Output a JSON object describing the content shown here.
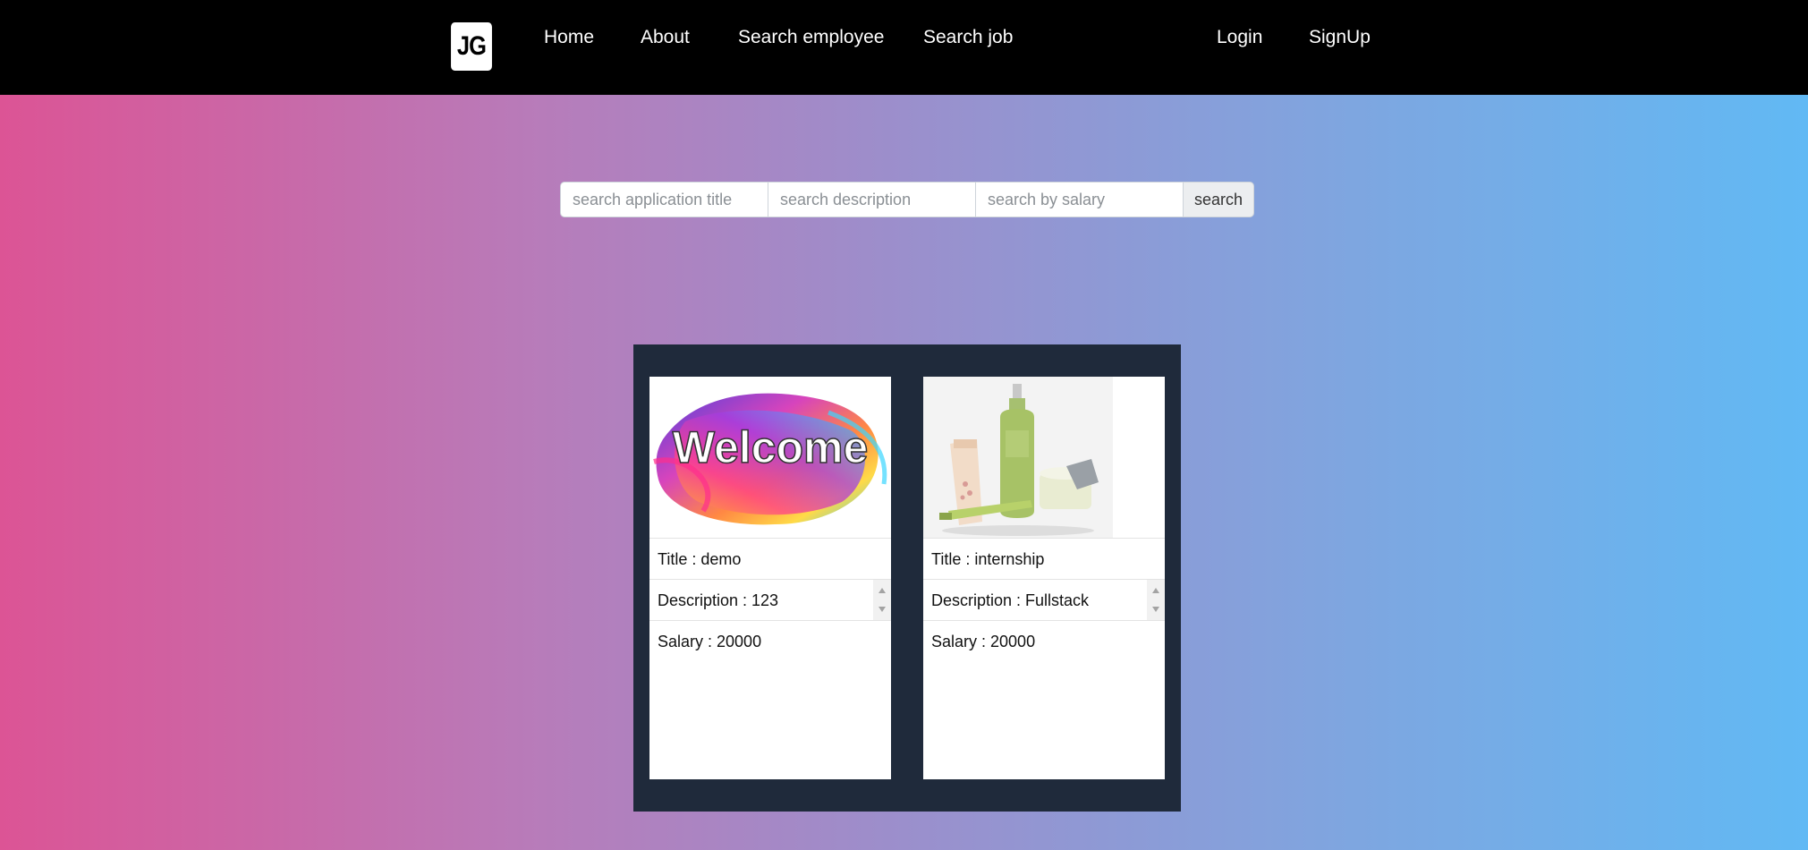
{
  "nav": {
    "logo": "JG",
    "links": [
      "Home",
      "About",
      "Search employee",
      "Search job"
    ],
    "auth": [
      "Login",
      "SignUp"
    ]
  },
  "search": {
    "title_placeholder": "search application title",
    "description_placeholder": "search description",
    "salary_placeholder": "search by salary",
    "button": "search"
  },
  "cards": [
    {
      "title": "Title : demo",
      "description": "Description : 123",
      "salary": "Salary : 20000",
      "image_word": "Welcome"
    },
    {
      "title": "Title : internship",
      "description": "Description : Fullstack",
      "salary": "Salary : 20000"
    }
  ]
}
